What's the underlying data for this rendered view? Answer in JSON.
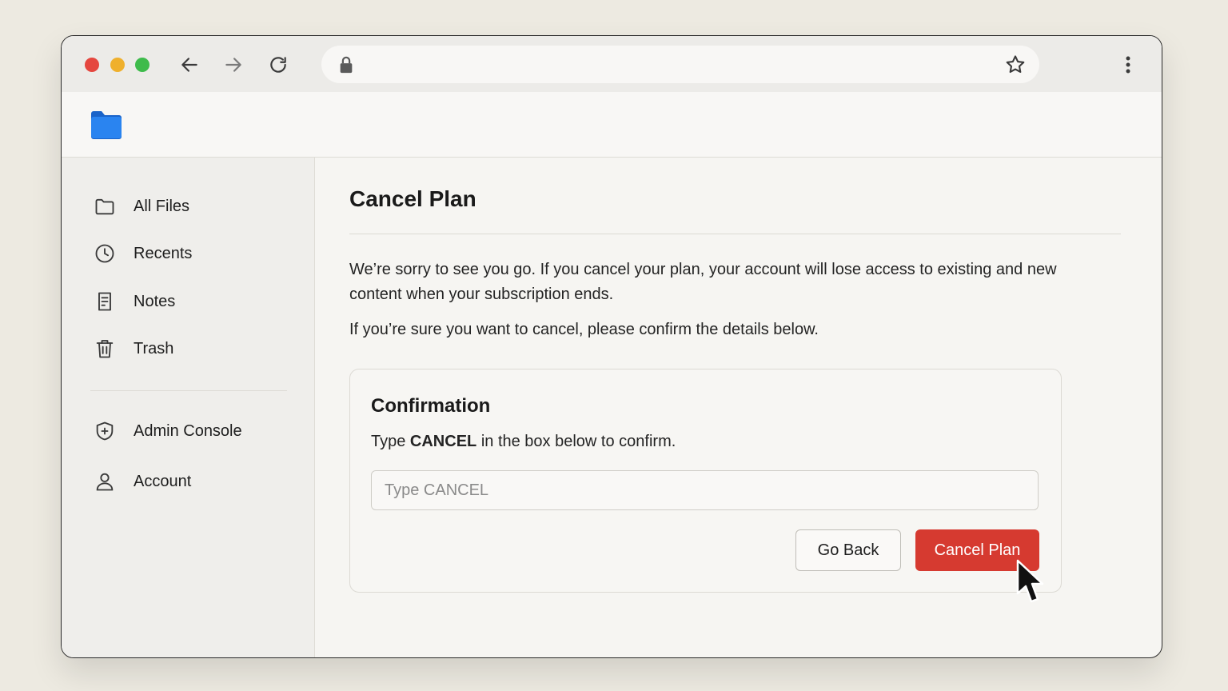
{
  "colors": {
    "accent_danger": "#d63a30",
    "folder_blue": "#1f78e8",
    "traffic_red": "#e5473f",
    "traffic_yellow": "#efb02d",
    "traffic_green": "#3ebb4b"
  },
  "browser": {
    "icons": [
      "arrow-left-icon",
      "arrow-right-icon",
      "reload-icon",
      "lock-icon",
      "star-icon",
      "kebab-menu-icon"
    ]
  },
  "sidebar": {
    "items": [
      {
        "label": "All Files",
        "icon": "folder-icon"
      },
      {
        "label": "Recents",
        "icon": "clock-icon"
      },
      {
        "label": "Notes",
        "icon": "note-icon"
      },
      {
        "label": "Trash",
        "icon": "trash-icon"
      },
      {
        "label": "Admin Console",
        "icon": "shield-plus-icon"
      },
      {
        "label": "Account",
        "icon": "user-icon"
      }
    ]
  },
  "main": {
    "title": "Cancel Plan",
    "paragraph1": "We’re sorry to see you go. If you cancel your plan, your account will lose access to existing and new content when your subscription ends.",
    "paragraph2": "If you’re sure you want to cancel, please confirm the details below.",
    "card": {
      "title": "Confirmation",
      "instruction_prefix": "Type ",
      "instruction_keyword": "CANCEL",
      "instruction_suffix": " in the box below to confirm.",
      "input_value": "",
      "input_placeholder": "Type CANCEL",
      "go_back_label": "Go Back",
      "cancel_label": "Cancel Plan"
    }
  }
}
